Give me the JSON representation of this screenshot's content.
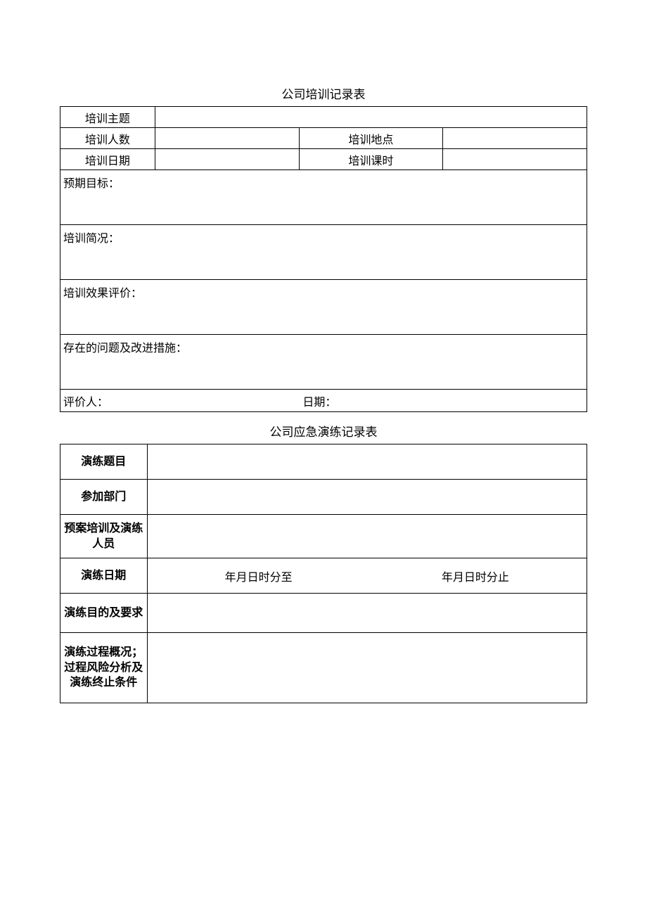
{
  "form1": {
    "title": "公司培训记录表",
    "labels": {
      "topic": "培训主题",
      "count": "培训人数",
      "location": "培训地点",
      "date": "培训日期",
      "hours": "培训课时",
      "goal": "预期目标：",
      "overview": "培训简况：",
      "effect": "培训效果评价：",
      "problems": "存在的问题及改进措施：",
      "evaluator": "评价人：",
      "evalDate": "日期："
    },
    "values": {
      "topic": "",
      "count": "",
      "location": "",
      "date": "",
      "hours": "",
      "goal": "",
      "overview": "",
      "effect": "",
      "problems": "",
      "evaluator": "",
      "evalDate": ""
    }
  },
  "form2": {
    "title": "公司应急演练记录表",
    "labels": {
      "subject": "演练题目",
      "dept": "参加部门",
      "personnel": "预案培训及演练人员",
      "date": "演练日期",
      "purpose": "演练目的及要求",
      "process": "演练过程概况；过程风险分析及演练终止条件"
    },
    "dateRange": {
      "from": "年月日时分至",
      "to": "年月日时分止"
    },
    "values": {
      "subject": "",
      "dept": "",
      "personnel": "",
      "purpose": "",
      "process": ""
    }
  }
}
